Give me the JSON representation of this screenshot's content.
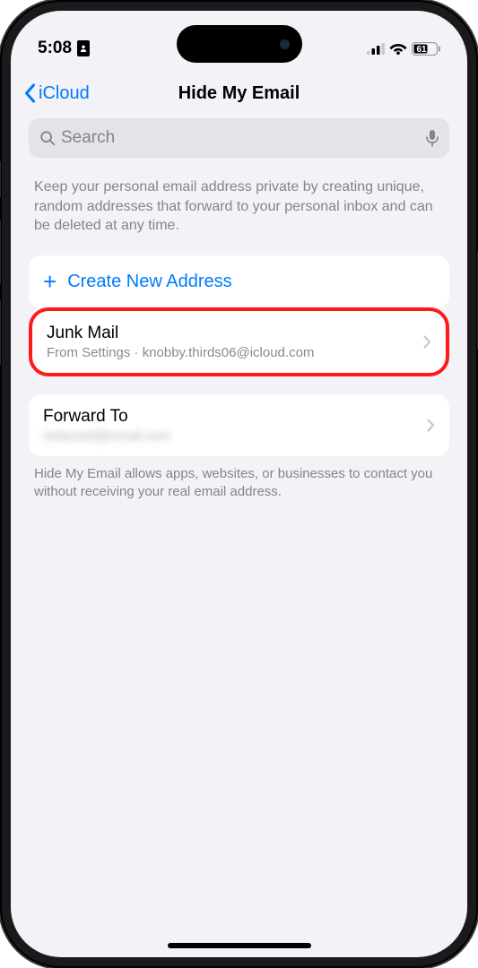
{
  "status": {
    "time": "5:08",
    "battery_text": "61"
  },
  "nav": {
    "back_label": "iCloud",
    "title": "Hide My Email"
  },
  "search": {
    "placeholder": "Search"
  },
  "intro": "Keep your personal email address private by creating unique, random addresses that forward to your personal inbox and can be deleted at any time.",
  "create": {
    "label": "Create New Address"
  },
  "addresses": [
    {
      "title": "Junk Mail",
      "subtitle": "From Settings · knobby.thirds06@icloud.com"
    }
  ],
  "forward": {
    "title": "Forward To",
    "subtitle": "redacted@email.com"
  },
  "footer": "Hide My Email allows apps, websites, or businesses to contact you without receiving your real email address."
}
